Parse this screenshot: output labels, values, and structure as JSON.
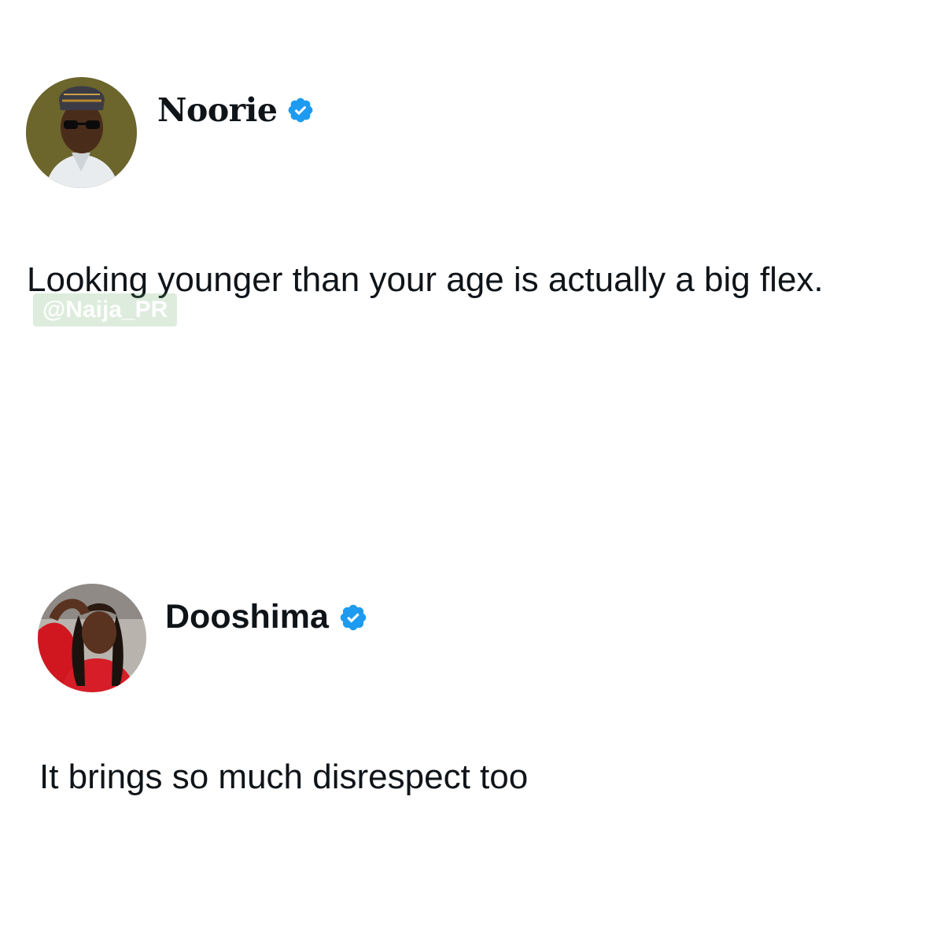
{
  "posts": [
    {
      "author": {
        "name": "Noorie",
        "verified": true,
        "avatar_icon": "profile-photo-man-cap-sunglasses"
      },
      "text": "Looking younger than your age is actually a big flex."
    },
    {
      "author": {
        "name": "Dooshima",
        "verified": true,
        "avatar_icon": "profile-photo-woman-braids-red-top"
      },
      "text": "It brings so much disrespect too"
    }
  ],
  "watermark": {
    "text": "@Naija_PR"
  },
  "colors": {
    "verified_badge": "#1d9bf0",
    "text": "#0f1419",
    "background": "#ffffff"
  }
}
